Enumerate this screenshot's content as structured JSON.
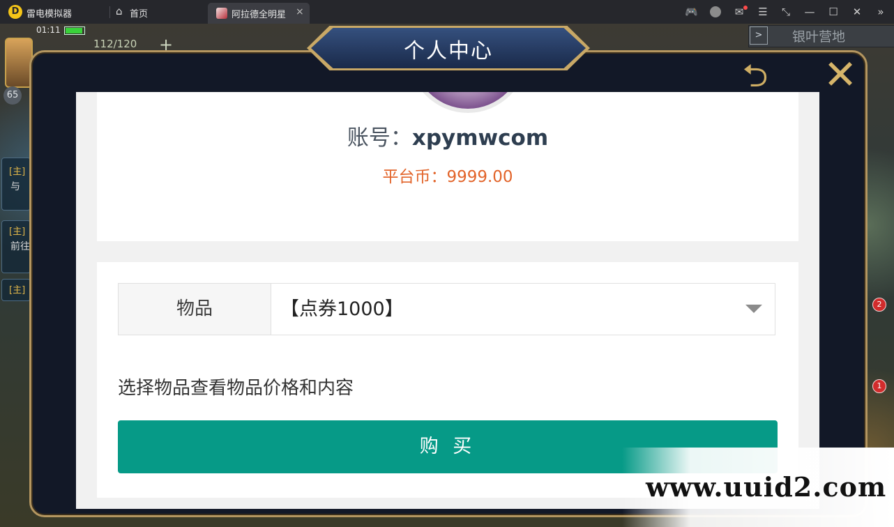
{
  "emulator": {
    "app_name": "雷电模拟器",
    "home_tab": "首页",
    "game_tab": "阿拉德全明星",
    "tab_close": "×",
    "toolbar_icons": [
      "gamepad-icon",
      "account-icon",
      "mail-icon",
      "menu-icon",
      "resize-icon",
      "minimize-icon",
      "maximize-icon",
      "close-icon",
      "collapse-icon"
    ]
  },
  "hud": {
    "time": "01:11",
    "battery_level": 0.85,
    "stamina": "112/120",
    "level": "65",
    "quests": [
      {
        "tag": "[主]",
        "text": "与"
      },
      {
        "tag": "[主]",
        "text": "前往"
      },
      {
        "tag": "[主]",
        "text": ""
      }
    ],
    "right_button": "银叶营地",
    "badges": [
      "2",
      "1"
    ]
  },
  "modal": {
    "title": "个人中心",
    "account_prefix": "账号：",
    "account_name": "xpymwcom",
    "balance": "平台币：9999.00",
    "item_label": "物品",
    "item_value": "【点券1000】",
    "hint": "选择物品查看物品价格和内容",
    "buy_label": "购 买"
  },
  "watermark": "www.uuid2.com",
  "colors": {
    "buy_button": "#069a87",
    "balance_text": "#e2642a",
    "frame_gold": "#b49660"
  }
}
